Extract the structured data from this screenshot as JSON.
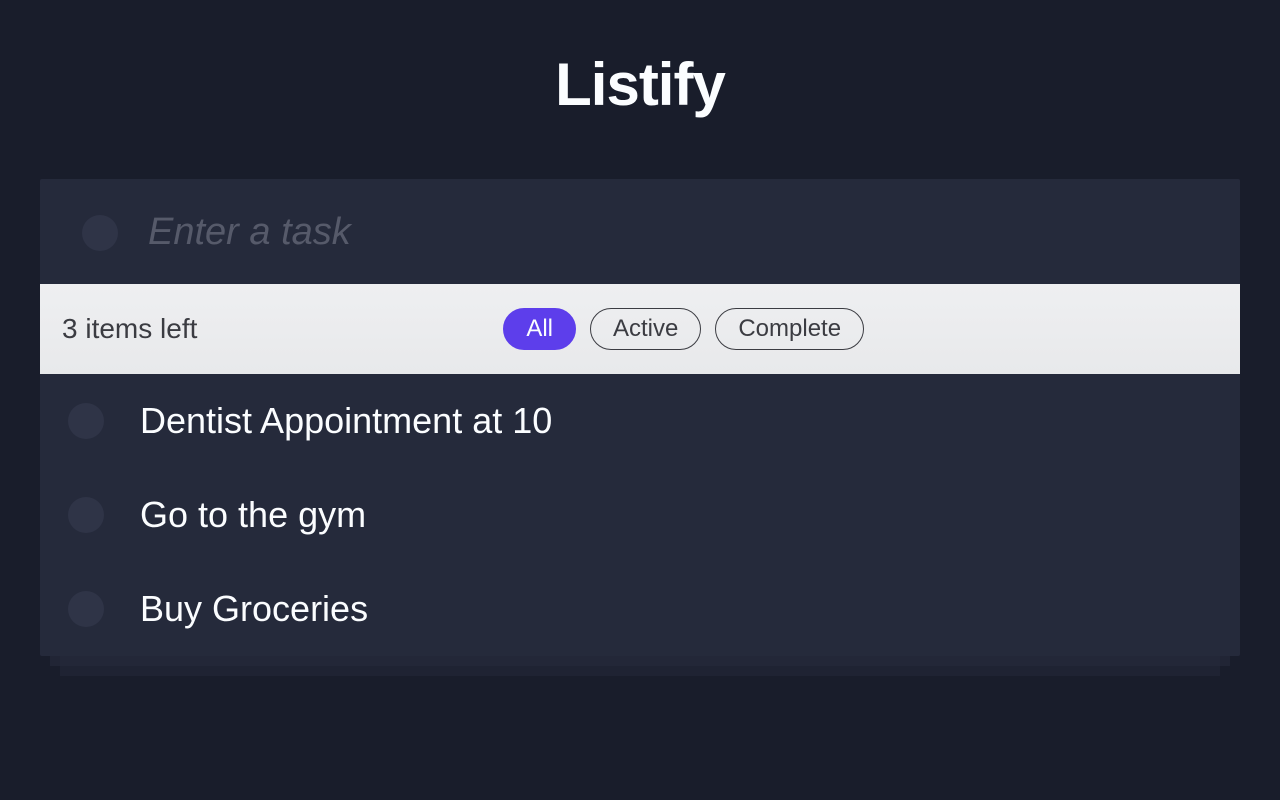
{
  "app": {
    "title": "Listify"
  },
  "input": {
    "placeholder": "Enter a task",
    "value": ""
  },
  "status": {
    "items_left": "3 items left"
  },
  "filters": [
    {
      "label": "All",
      "active": true
    },
    {
      "label": "Active",
      "active": false
    },
    {
      "label": "Complete",
      "active": false
    }
  ],
  "tasks": [
    {
      "text": "Dentist Appointment at 10",
      "completed": false
    },
    {
      "text": "Go to the gym",
      "completed": false
    },
    {
      "text": "Buy Groceries",
      "completed": false
    }
  ]
}
